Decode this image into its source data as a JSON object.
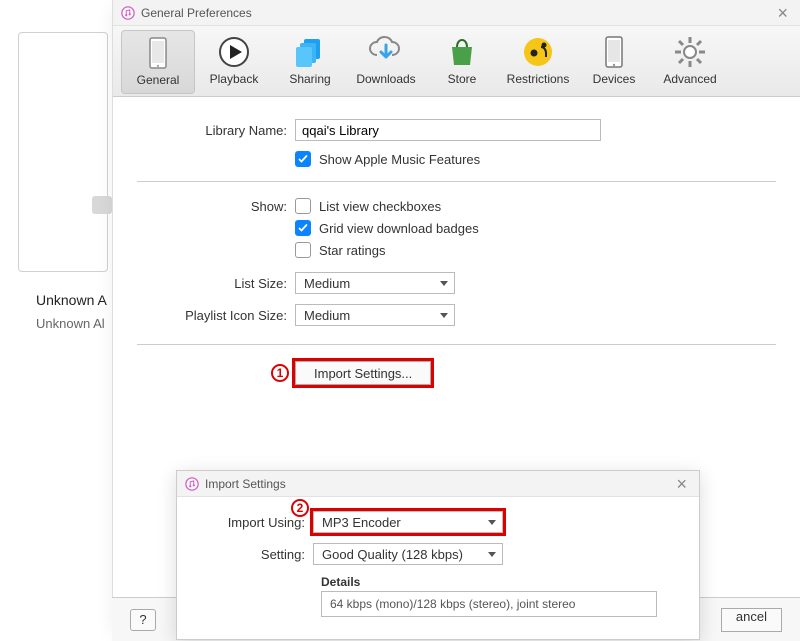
{
  "background": {
    "artist": "Unknown A",
    "album": "Unknown Al"
  },
  "prefs": {
    "title": "General Preferences",
    "tabs": [
      {
        "label": "General"
      },
      {
        "label": "Playback"
      },
      {
        "label": "Sharing"
      },
      {
        "label": "Downloads"
      },
      {
        "label": "Store"
      },
      {
        "label": "Restrictions"
      },
      {
        "label": "Devices"
      },
      {
        "label": "Advanced"
      }
    ],
    "libraryName": {
      "label": "Library Name:",
      "value": "qqai's Library"
    },
    "showAppleMusic": {
      "label": "Show Apple Music Features"
    },
    "showHeader": "Show:",
    "showOpts": [
      {
        "label": "List view checkboxes",
        "checked": false
      },
      {
        "label": "Grid view download badges",
        "checked": true
      },
      {
        "label": "Star ratings",
        "checked": false
      }
    ],
    "listSize": {
      "label": "List Size:",
      "value": "Medium"
    },
    "playlistIconSize": {
      "label": "Playlist Icon Size:",
      "value": "Medium"
    },
    "importSettingsBtn": "Import Settings...",
    "annot": {
      "one": "1",
      "two": "2"
    }
  },
  "importSettings": {
    "title": "Import Settings",
    "importUsing": {
      "label": "Import Using:",
      "value": "MP3 Encoder"
    },
    "setting": {
      "label": "Setting:",
      "value": "Good Quality (128 kbps)"
    },
    "detailsLabel": "Details",
    "detailsText": "64 kbps (mono)/128 kbps (stereo), joint stereo"
  },
  "bottom": {
    "help": "?",
    "cancel": "ancel"
  }
}
